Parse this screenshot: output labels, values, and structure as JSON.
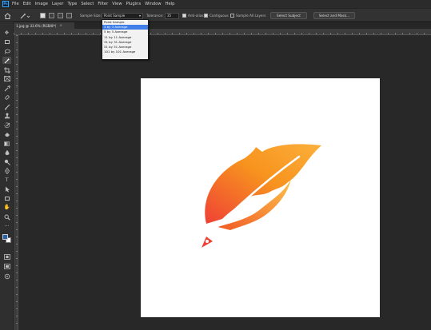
{
  "menu": [
    "File",
    "Edit",
    "Image",
    "Layer",
    "Type",
    "Select",
    "Filter",
    "View",
    "Plugins",
    "Window",
    "Help"
  ],
  "options_bar": {
    "sample_size_label": "Sample Size:",
    "sample_size_value": "Point Sample",
    "tolerance_label": "Tolerance:",
    "tolerance_value": "35",
    "anti_alias_label": "Anti-alias",
    "anti_alias_checked": true,
    "contiguous_label": "Contiguous",
    "contiguous_checked": true,
    "sample_all_layers_label": "Sample All Layers",
    "sample_all_layers_checked": false,
    "select_subject_label": "Select Subject",
    "select_mask_label": "Select and Mask..."
  },
  "sample_size_dropdown": {
    "options": [
      "Point Sample",
      "3 by 3 Average",
      "5 by 5 Average",
      "11 by 11 Average",
      "31 by 31 Average",
      "51 by 51 Average",
      "101 by 101 Average"
    ],
    "highlighted_index": 1
  },
  "document_tab": {
    "title": "1.jpg @ 33.6% (RGB/8*)",
    "close_glyph": "×"
  },
  "colors": {
    "accent": "#3f7ee8",
    "ps_blue": "#31a8ff",
    "feather_orange": "#f7931e",
    "feather_red": "#ef4136",
    "feather_yellow": "#fbb03b"
  }
}
